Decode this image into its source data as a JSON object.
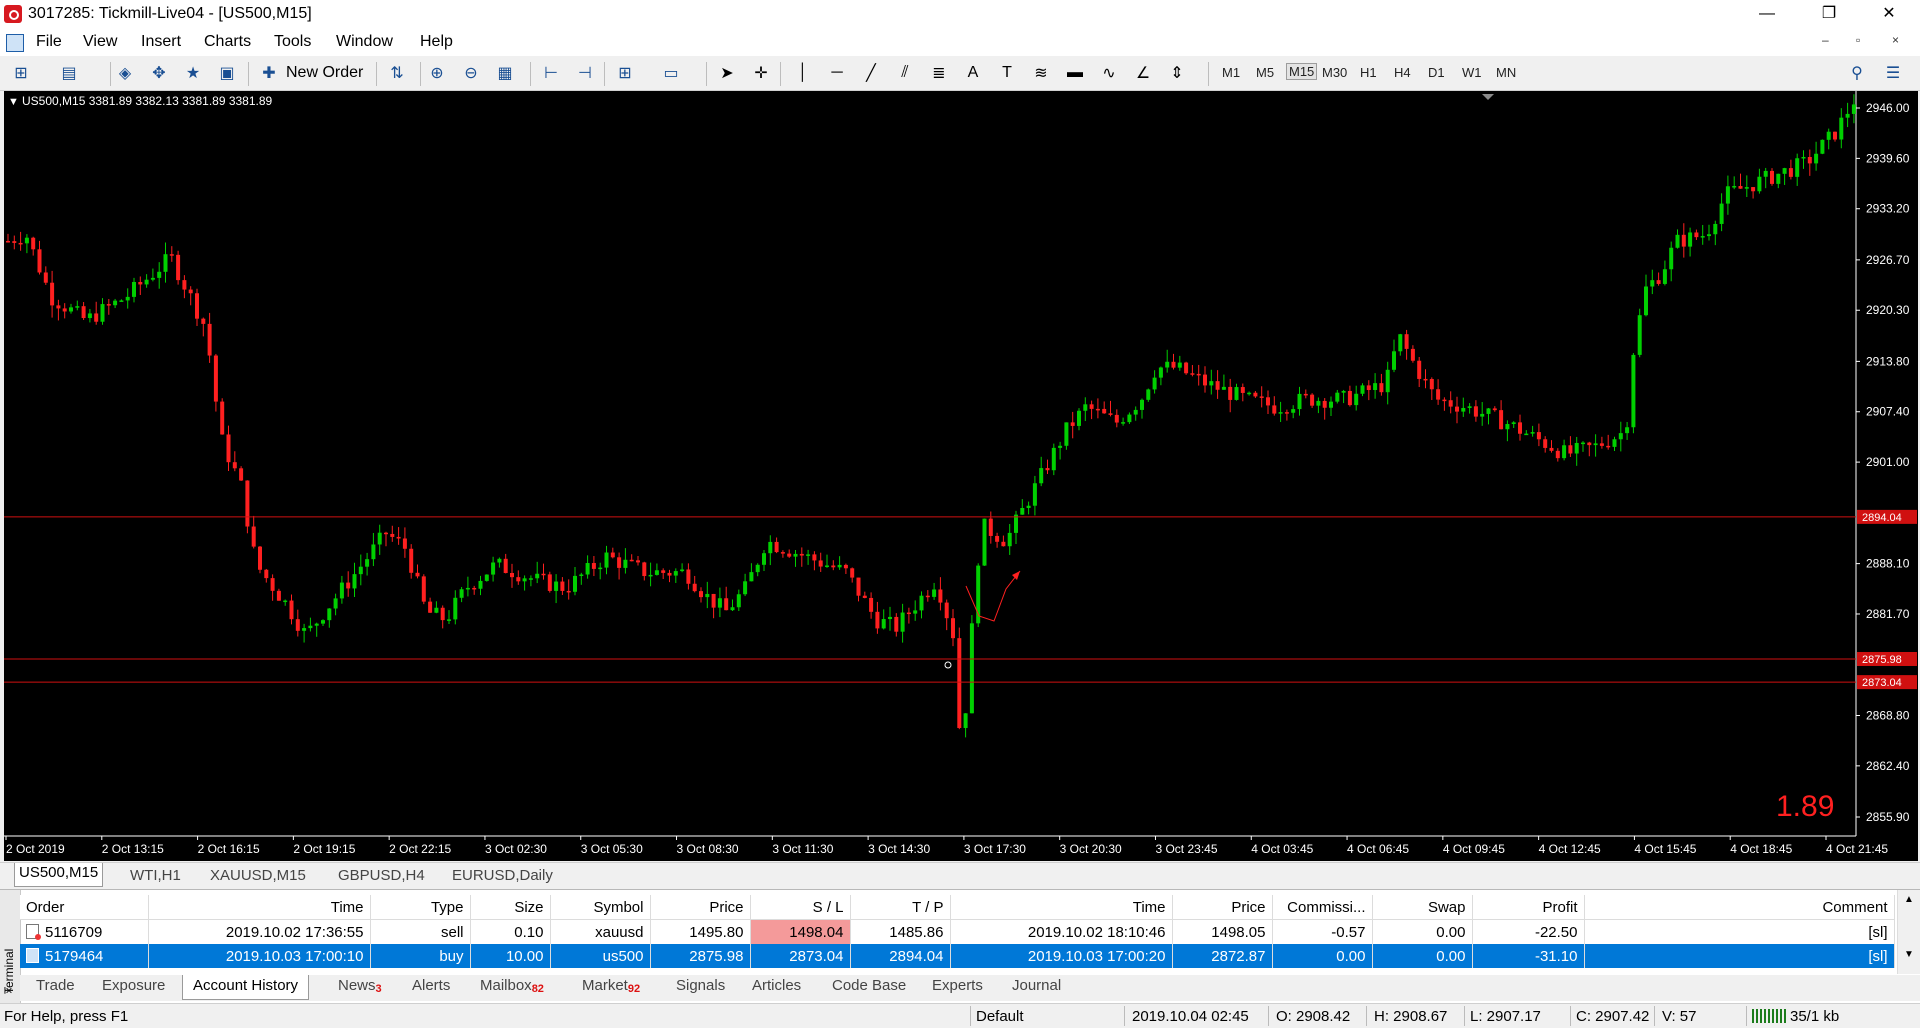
{
  "window": {
    "title": "3017285: Tickmill-Live04 - [US500,M15]",
    "minimize": "—",
    "restore": "❐",
    "close": "✕"
  },
  "menu": {
    "items": [
      "File",
      "View",
      "Insert",
      "Charts",
      "Tools",
      "Window",
      "Help"
    ],
    "mdi": [
      "–",
      "▫",
      "×"
    ]
  },
  "toolbar": {
    "new_order_label": "New Order",
    "timeframes": [
      "M1",
      "M5",
      "M15",
      "M30",
      "H1",
      "H4",
      "D1",
      "W1",
      "MN"
    ],
    "active_timeframe": "M15"
  },
  "chart": {
    "header": "US500,M15  3381.89 3382.13 3381.89 3381.89",
    "spread_value": "1.89",
    "colors": {
      "background": "#000000",
      "up": "#00d000",
      "down": "#ff2020",
      "level": "#d01010",
      "axis_text": "#ffffff",
      "spread": "#ff2020"
    },
    "price_axis": [
      "2946.00",
      "2939.60",
      "2933.20",
      "2926.70",
      "2920.30",
      "2913.80",
      "2907.40",
      "2901.00",
      "2888.10",
      "2881.70",
      "2868.80",
      "2862.40",
      "2855.90"
    ],
    "level_labels": [
      "2894.04",
      "2875.98",
      "2873.04"
    ],
    "time_axis": [
      "2 Oct 2019",
      "2 Oct 13:15",
      "2 Oct 16:15",
      "2 Oct 19:15",
      "2 Oct 22:15",
      "3 Oct 02:30",
      "3 Oct 05:30",
      "3 Oct 08:30",
      "3 Oct 11:30",
      "3 Oct 14:30",
      "3 Oct 17:30",
      "3 Oct 20:30",
      "3 Oct 23:45",
      "4 Oct 03:45",
      "4 Oct 06:45",
      "4 Oct 09:45",
      "4 Oct 12:45",
      "4 Oct 15:45",
      "4 Oct 18:45",
      "4 Oct 21:45"
    ]
  },
  "symbol_tabs": [
    "US500,M15",
    "WTI,H1",
    "XAUUSD,M15",
    "GBPUSD,H4",
    "EURUSD,Daily"
  ],
  "terminal": {
    "side_label": "Terminal",
    "close_icon": "×",
    "columns": [
      "Order",
      "Time",
      "Type",
      "Size",
      "Symbol",
      "Price",
      "S / L",
      "T / P",
      "Time",
      "Price",
      "Commissi...",
      "Swap",
      "Profit",
      "Comment"
    ],
    "rows": [
      {
        "order": "5116709",
        "time": "2019.10.02 17:36:55",
        "type": "sell",
        "size": "0.10",
        "symbol": "xauusd",
        "price": "1495.80",
        "sl": "1498.04",
        "tp": "1485.86",
        "close_time": "2019.10.02 18:10:46",
        "close_price": "1498.05",
        "commission": "-0.57",
        "swap": "0.00",
        "profit": "-22.50",
        "comment": "[sl]"
      },
      {
        "order": "5179464",
        "time": "2019.10.03 17:00:10",
        "type": "buy",
        "size": "10.00",
        "symbol": "us500",
        "price": "2875.98",
        "sl": "2873.04",
        "tp": "2894.04",
        "close_time": "2019.10.03 17:00:20",
        "close_price": "2872.87",
        "commission": "0.00",
        "swap": "0.00",
        "profit": "-31.10",
        "comment": "[sl]"
      }
    ],
    "tabs": [
      {
        "label": "Trade"
      },
      {
        "label": "Exposure"
      },
      {
        "label": "Account History"
      },
      {
        "label": "News",
        "badge": "3"
      },
      {
        "label": "Alerts"
      },
      {
        "label": "Mailbox",
        "badge": "82"
      },
      {
        "label": "Market",
        "badge": "92"
      },
      {
        "label": "Signals"
      },
      {
        "label": "Articles"
      },
      {
        "label": "Code Base"
      },
      {
        "label": "Experts"
      },
      {
        "label": "Journal"
      }
    ],
    "active_tab": "Account History"
  },
  "status": {
    "help": "For Help, press F1",
    "profile": "Default",
    "datetime": "2019.10.04 02:45",
    "open": "O: 2908.42",
    "high": "H: 2908.67",
    "low": "L: 2907.17",
    "close": "C: 2907.42",
    "volume": "V: 57",
    "traffic": "35/1 kb"
  }
}
